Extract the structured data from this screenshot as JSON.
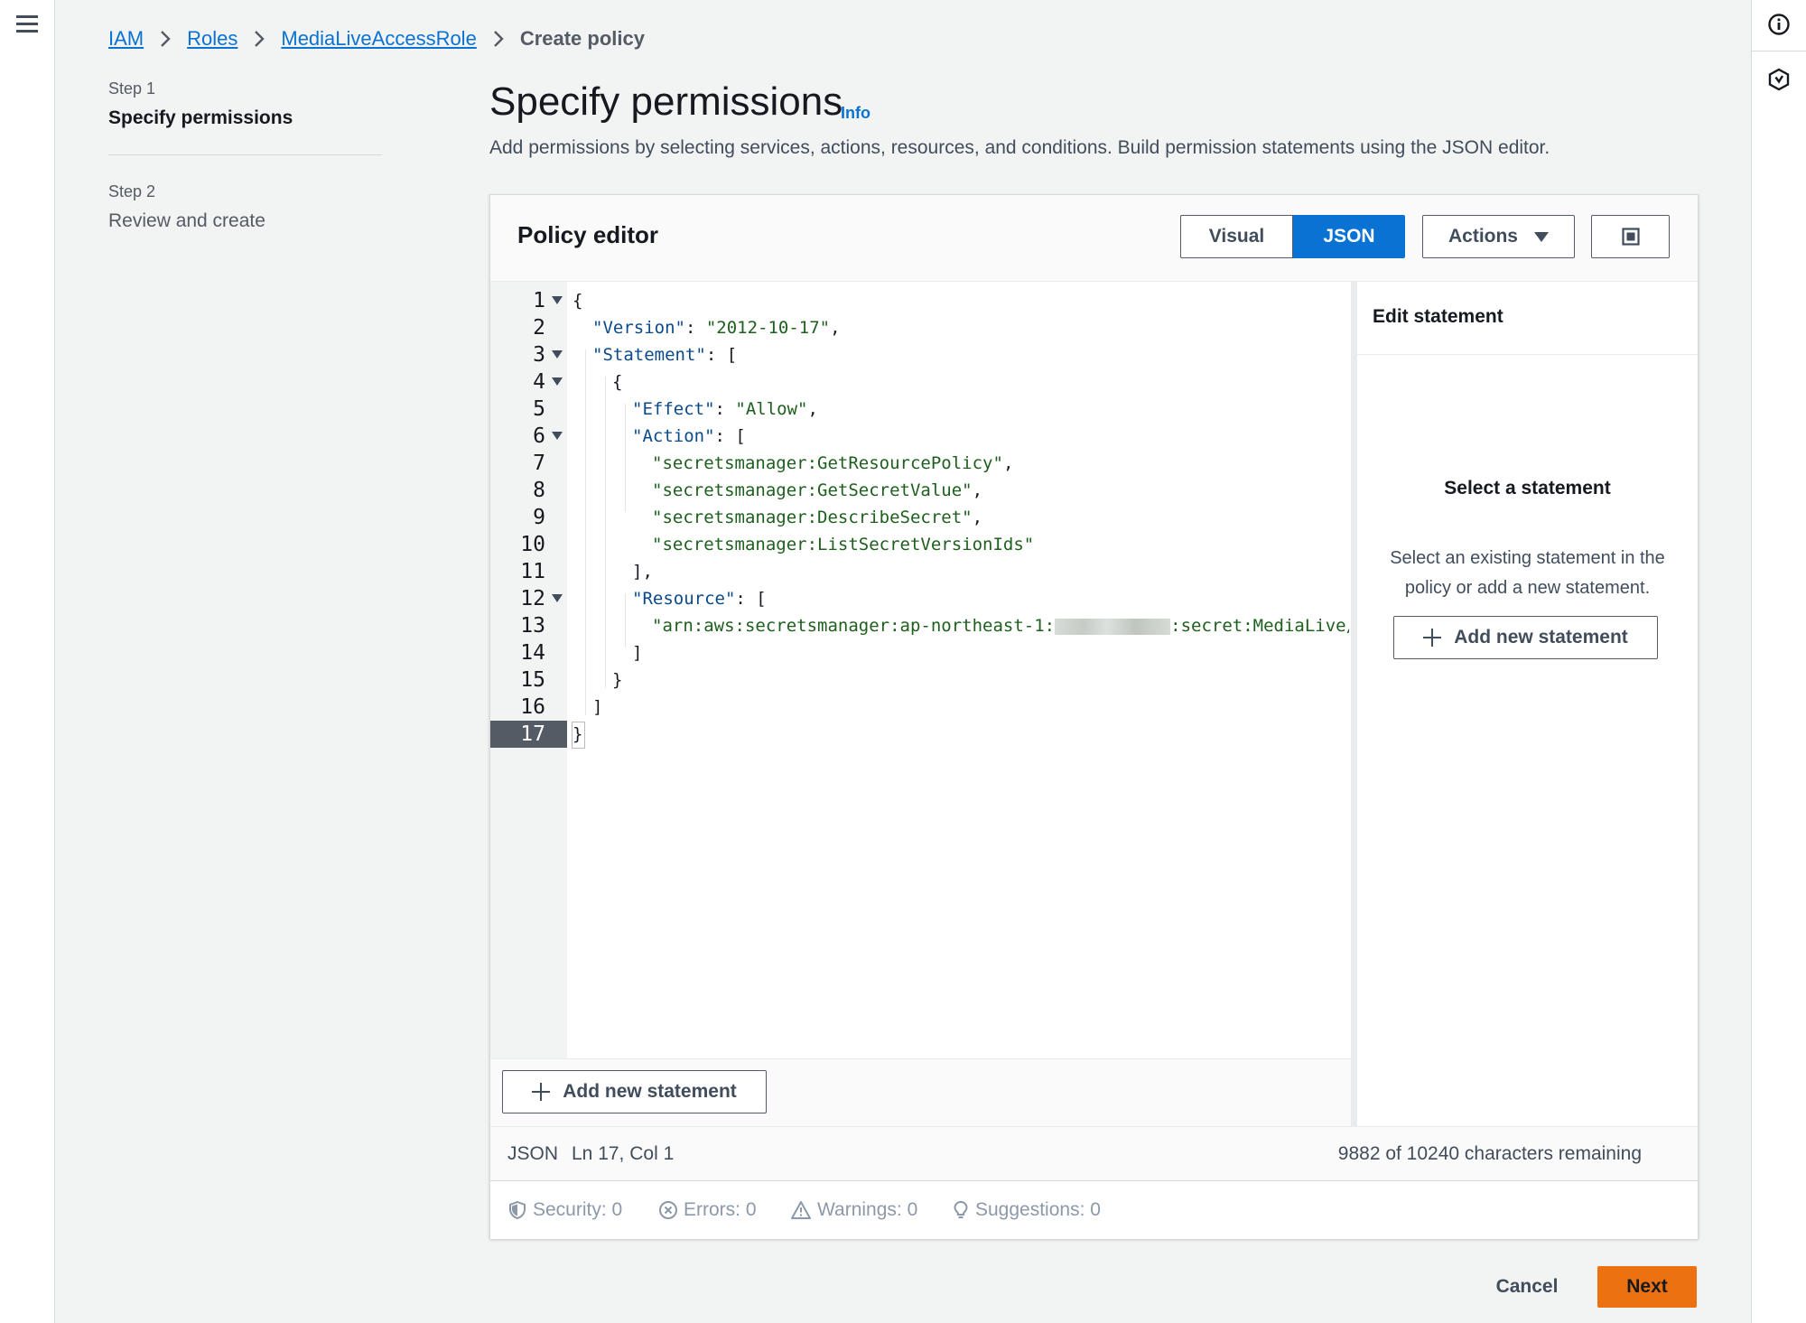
{
  "breadcrumb": {
    "iam": "IAM",
    "roles": "Roles",
    "role": "MediaLiveAccessRole",
    "current": "Create policy"
  },
  "steps": {
    "step1_label": "Step 1",
    "step1_title": "Specify permissions",
    "step2_label": "Step 2",
    "step2_title": "Review and create"
  },
  "header": {
    "title": "Specify permissions",
    "info": "Info",
    "description": "Add permissions by selecting services, actions, resources, and conditions. Build permission statements using the JSON editor."
  },
  "editor": {
    "title": "Policy editor",
    "visual_label": "Visual",
    "json_label": "JSON",
    "actions_label": "Actions",
    "active_mode": "JSON"
  },
  "code": {
    "line_numbers": [
      "1",
      "2",
      "3",
      "4",
      "5",
      "6",
      "7",
      "8",
      "9",
      "10",
      "11",
      "12",
      "13",
      "14",
      "15",
      "16",
      "17"
    ],
    "folded_lines": [
      1,
      3,
      4,
      6,
      12
    ],
    "active_line": 17,
    "lines": {
      "l1": "{",
      "l2_key": "\"Version\"",
      "l2_sep": ": ",
      "l2_val": "\"2012-10-17\"",
      "l2_end": ",",
      "l3_key": "\"Statement\"",
      "l3_end": ": [",
      "l4": "{",
      "l5_key": "\"Effect\"",
      "l5_sep": ": ",
      "l5_val": "\"Allow\"",
      "l5_end": ",",
      "l6_key": "\"Action\"",
      "l6_end": ": [",
      "l7_val": "\"secretsmanager:GetResourcePolicy\"",
      "l7_end": ",",
      "l8_val": "\"secretsmanager:GetSecretValue\"",
      "l8_end": ",",
      "l9_val": "\"secretsmanager:DescribeSecret\"",
      "l9_end": ",",
      "l10_val": "\"secretsmanager:ListSecretVersionIds\"",
      "l11": "],",
      "l12_key": "\"Resource\"",
      "l12_end": ": [",
      "l13_pre": "\"arn:aws:secretsmanager:ap-northeast-1:",
      "l13_post": ":secret:MediaLive/SRT",
      "l14": "]",
      "l15": "}",
      "l16": "]",
      "l17": "}"
    }
  },
  "side_panel": {
    "title": "Edit statement",
    "empty_title": "Select a statement",
    "empty_desc": "Select an existing statement in the policy or add a new statement.",
    "add_label": "Add new statement"
  },
  "add_statement_label": "Add new statement",
  "status": {
    "language": "JSON",
    "position": "Ln 17, Col 1",
    "remaining": "9882 of 10240 characters remaining"
  },
  "problems": {
    "security": "Security: 0",
    "errors": "Errors: 0",
    "warnings": "Warnings: 0",
    "suggestions": "Suggestions: 0"
  },
  "footer": {
    "cancel": "Cancel",
    "next": "Next"
  },
  "colors": {
    "accent": "#0972d3",
    "primary_button": "#ec7211",
    "json_key": "#0a4a8c",
    "json_string": "#1d5f1d"
  },
  "icons": [
    "menu-icon",
    "info-circle-icon",
    "hexagon-help-icon",
    "chevron-right-icon",
    "caret-down-icon",
    "fullscreen-icon",
    "plus-icon",
    "shield-icon",
    "error-circle-icon",
    "warning-triangle-icon",
    "lightbulb-icon"
  ]
}
